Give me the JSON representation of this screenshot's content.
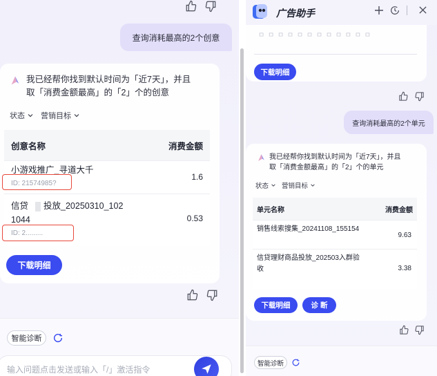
{
  "left": {
    "user_query": "查询消耗最高的2个创意",
    "bot_message_line1": "我已经帮你找到默认时间为「近7天」，并且",
    "bot_message_line2": "取「消费金额最高」的「2」个的创意",
    "filters": [
      "状态",
      "营销目标"
    ],
    "table": {
      "col_name": "创意名称",
      "col_value": "消费金额",
      "rows": [
        {
          "name": "小游戏推广_寻道大千",
          "id": "ID: 21574985?",
          "value": "1.6"
        },
        {
          "name_prefix": "信贷",
          "name_suffix": "投放_20250310_102",
          "name_line2": "1044",
          "id": "ID: 2.........",
          "value": "0.53"
        }
      ]
    },
    "download_label": "下载明细",
    "diagnose_chip": "智能诊断",
    "input_placeholder": "输入问题点击发送或输入「/」激活指令"
  },
  "right": {
    "app_title": "广告助手",
    "faded_text": "ㅁ ㅁ ㅁ ㅁ ㅁ ㅁ ㅁ ㅁ ㅁ ㅁ ㅁ ㅁ",
    "download_label_top": "下载明细",
    "user_query": "查询消耗最高的2个单元",
    "bot_message_line1": "我已经帮你找到默认时间为「近7天」，并且",
    "bot_message_line2": "取「消费金额最高」的「2」个的单元",
    "filters": [
      "状态",
      "营销目标"
    ],
    "table": {
      "col_name": "单元名称",
      "col_value": "消费金额",
      "rows": [
        {
          "name": "销售线索搜集_20241108_155154",
          "value": "9.63"
        },
        {
          "name": "信贷理财商品投放_202503入群验",
          "name_line2": "收",
          "value": "3.38"
        }
      ]
    },
    "download_label": "下载明细",
    "diagnose_label": "诊 断",
    "diagnose_chip": "智能诊断"
  },
  "colors": {
    "accent": "#3a4bf0",
    "bubble": "#e2def9",
    "highlight": "#e8483b"
  }
}
